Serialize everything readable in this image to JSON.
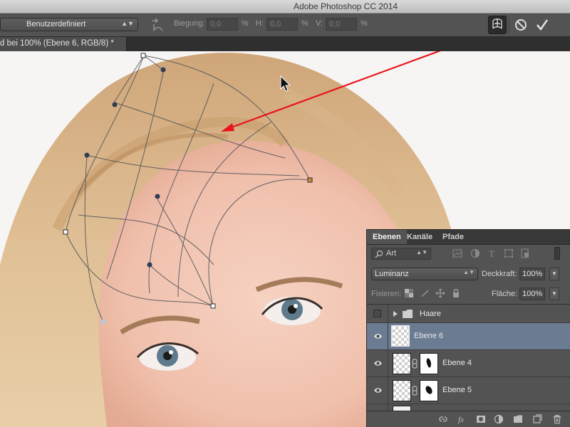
{
  "window": {
    "title": "Adobe Photoshop CC 2014"
  },
  "options_bar": {
    "preset_value": "Benutzerdefiniert",
    "bend_label": "Biegung:",
    "bend_value": "0,0",
    "h_label": "H:",
    "h_value": "0,0",
    "v_label": "V:",
    "v_value": "0,0",
    "percent": "%"
  },
  "document_tab": {
    "label": "d bei 100% (Ebene 6, RGB/8) *"
  },
  "layers_panel": {
    "tabs": [
      {
        "label": "Ebenen"
      },
      {
        "label": "Kanäle"
      },
      {
        "label": "Pfade"
      }
    ],
    "filter_kind": "Art",
    "blend_mode": "Luminanz",
    "opacity_label": "Deckkraft:",
    "opacity_value": "100%",
    "lock_label": "Fixieren:",
    "fill_label": "Fläche:",
    "fill_value": "100%",
    "layers": [
      {
        "name": "Haare"
      },
      {
        "name": "Ebene 6"
      },
      {
        "name": "Ebene 4"
      },
      {
        "name": "Ebene 5"
      }
    ]
  },
  "colors": {
    "accent_arrow": "#e8141b",
    "selected_row": "#6b7c92",
    "panel_bg": "#535353"
  }
}
